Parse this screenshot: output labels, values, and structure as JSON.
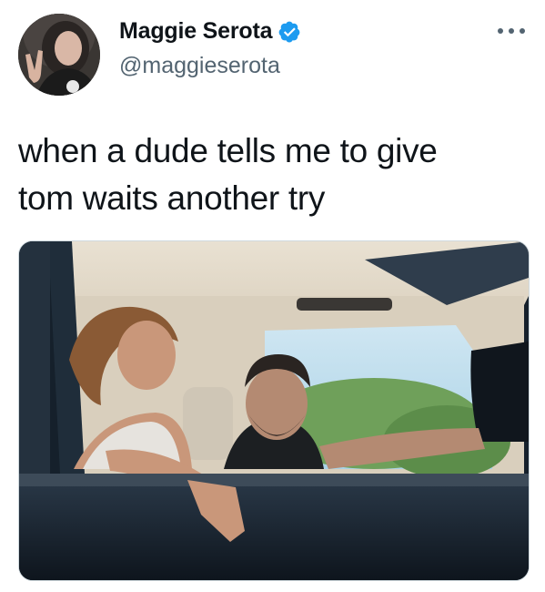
{
  "author": {
    "display_name": "Maggie Serota",
    "handle": "@maggieserota",
    "verified": true,
    "avatar_icon": "profile-photo"
  },
  "tweet": {
    "text": "when a dude tells me to give\ntom waits another try"
  },
  "icons": {
    "more": "more-options-icon",
    "verified": "verified-badge-icon"
  },
  "colors": {
    "verified_blue": "#1d9bf0",
    "text_primary": "#0f1419",
    "text_secondary": "#536471"
  }
}
